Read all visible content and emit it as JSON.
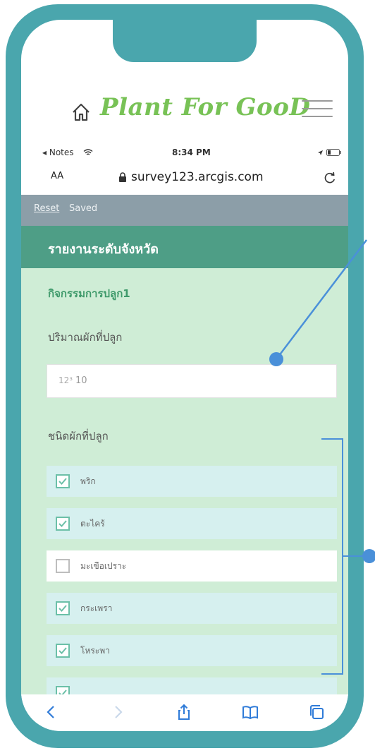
{
  "app": {
    "title": "Plant For GooD",
    "icons": {
      "home": "home-icon",
      "menu": "hamburger-menu-icon"
    }
  },
  "status_bar": {
    "back_app": "◂ Notes",
    "time": "8:34 PM"
  },
  "browser": {
    "text_size": "AA",
    "url": "survey123.arcgis.com"
  },
  "form": {
    "toolbar": {
      "reset": "Reset",
      "saved": "Saved"
    },
    "header_title": "รายงานระดับจังหวัด",
    "group_title": "กิจกรรมการปลูก1",
    "quantity_label": "ปริมาณผักที่ปลูก",
    "quantity_prefix": "12³",
    "quantity_value": "10",
    "vegetable_type_label": "ชนิดผักที่ปลูก",
    "choices": [
      {
        "label": "พริก",
        "checked": true
      },
      {
        "label": "ตะไคร้",
        "checked": true
      },
      {
        "label": "มะเขือเปราะ",
        "checked": false
      },
      {
        "label": "กระเพรา",
        "checked": true
      },
      {
        "label": "โหระพา",
        "checked": true
      },
      {
        "label": "",
        "checked": true
      }
    ]
  },
  "colors": {
    "frame": "#4aa6ad",
    "title_green": "#78c256",
    "header_green": "#4e9e86",
    "form_bg": "#cfedd6",
    "callout_blue": "#4a90d9"
  }
}
